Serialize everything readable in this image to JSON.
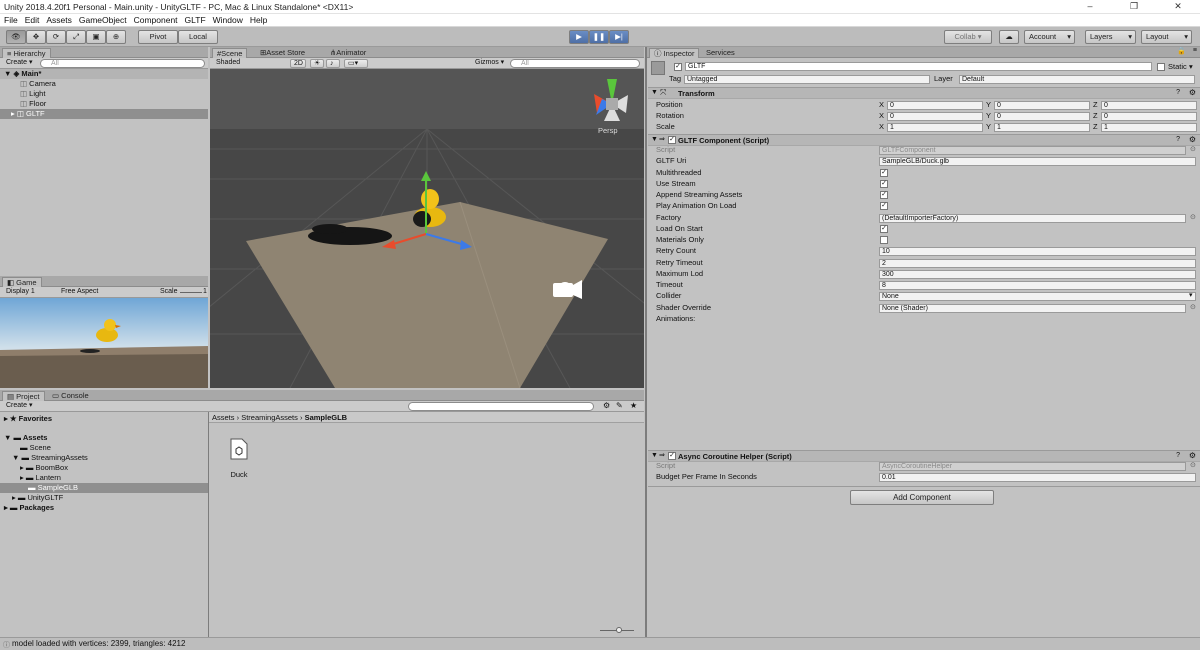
{
  "window": {
    "title": "Unity 2018.4.20f1 Personal - Main.unity - UnityGLTF - PC, Mac & Linux Standalone* <DX11>",
    "minimize": "–",
    "maximize": "❐",
    "close": "✕"
  },
  "menu": [
    "File",
    "Edit",
    "Assets",
    "GameObject",
    "Component",
    "GLTF",
    "Window",
    "Help"
  ],
  "toolbar": {
    "pivot": "Pivot",
    "local": "Local",
    "collab": "Collab ▾",
    "account": "Account",
    "layers": "Layers",
    "layout": "Layout"
  },
  "hierarchy": {
    "tab": "Hierarchy",
    "create": "Create ▾",
    "search_placeholder": "All",
    "scene": "Main*",
    "items": [
      "Camera",
      "Light",
      "Floor",
      "GLTF"
    ]
  },
  "scene_view": {
    "tabs": [
      "Scene",
      "Asset Store",
      "Animator"
    ],
    "shading": "Shaded",
    "mode_2d": "2D",
    "gizmos": "Gizmos ▾",
    "search_placeholder": "All",
    "persp": "Persp"
  },
  "game_view": {
    "tab": "Game",
    "display": "Display 1",
    "aspect": "Free Aspect",
    "scale_label": "Scale",
    "scale_value": "1"
  },
  "project": {
    "tabs": [
      "Project",
      "Console"
    ],
    "create": "Create ▾",
    "favorites": "Favorites",
    "assets": "Assets",
    "tree": [
      "Scene",
      "StreamingAssets",
      "BoomBox",
      "Lantern",
      "SampleGLB",
      "UnityGLTF"
    ],
    "packages": "Packages",
    "breadcrumb": [
      "Assets",
      "StreamingAssets",
      "SampleGLB"
    ],
    "files": [
      "Duck"
    ]
  },
  "inspector": {
    "tabs": [
      "Inspector",
      "Services"
    ],
    "object_name": "GLTF",
    "static_label": "Static",
    "tag_label": "Tag",
    "tag_value": "Untagged",
    "layer_label": "Layer",
    "layer_value": "Default",
    "transform": {
      "title": "Transform",
      "rows": [
        {
          "label": "Position",
          "x": "0",
          "y": "0",
          "z": "0"
        },
        {
          "label": "Rotation",
          "x": "0",
          "y": "0",
          "z": "0"
        },
        {
          "label": "Scale",
          "x": "1",
          "y": "1",
          "z": "1"
        }
      ]
    },
    "gltf_component": {
      "title": "GLTF Component (Script)",
      "fields": [
        {
          "label": "Script",
          "value": "GLTFComponent",
          "type": "script"
        },
        {
          "label": "GLTF Uri",
          "value": "SampleGLB/Duck.glb",
          "type": "text"
        },
        {
          "label": "Multithreaded",
          "value": "✓",
          "type": "check"
        },
        {
          "label": "Use Stream",
          "value": "✓",
          "type": "check"
        },
        {
          "label": "Append Streaming Assets",
          "value": "✓",
          "type": "check"
        },
        {
          "label": "Play Animation On Load",
          "value": "✓",
          "type": "check"
        },
        {
          "label": "Factory",
          "value": "(DefaultImporterFactory)",
          "type": "object"
        },
        {
          "label": "Load On Start",
          "value": "✓",
          "type": "check"
        },
        {
          "label": "Materials Only",
          "value": "",
          "type": "check"
        },
        {
          "label": "Retry Count",
          "value": "10",
          "type": "text"
        },
        {
          "label": "Retry Timeout",
          "value": "2",
          "type": "text"
        },
        {
          "label": "Maximum Lod",
          "value": "300",
          "type": "text"
        },
        {
          "label": "Timeout",
          "value": "8",
          "type": "text"
        },
        {
          "label": "Collider",
          "value": "None",
          "type": "dropdown"
        },
        {
          "label": "Shader Override",
          "value": "None (Shader)",
          "type": "object"
        },
        {
          "label": "Animations:",
          "value": "",
          "type": "label"
        }
      ]
    },
    "async_helper": {
      "title": "Async Coroutine Helper (Script)",
      "fields": [
        {
          "label": "Script",
          "value": "AsyncCoroutineHelper",
          "type": "script"
        },
        {
          "label": "Budget Per Frame In Seconds",
          "value": "0.01",
          "type": "text"
        }
      ]
    },
    "add_component": "Add Component"
  },
  "status": {
    "message": "model loaded with vertices: 2399, triangles: 4212"
  },
  "colors": {
    "play_active": "#5a7db8",
    "selection": "#8f8f8f",
    "scene_bg": "#4a4a4a",
    "floor": "#8f8472",
    "duck": "#f2c21a"
  }
}
